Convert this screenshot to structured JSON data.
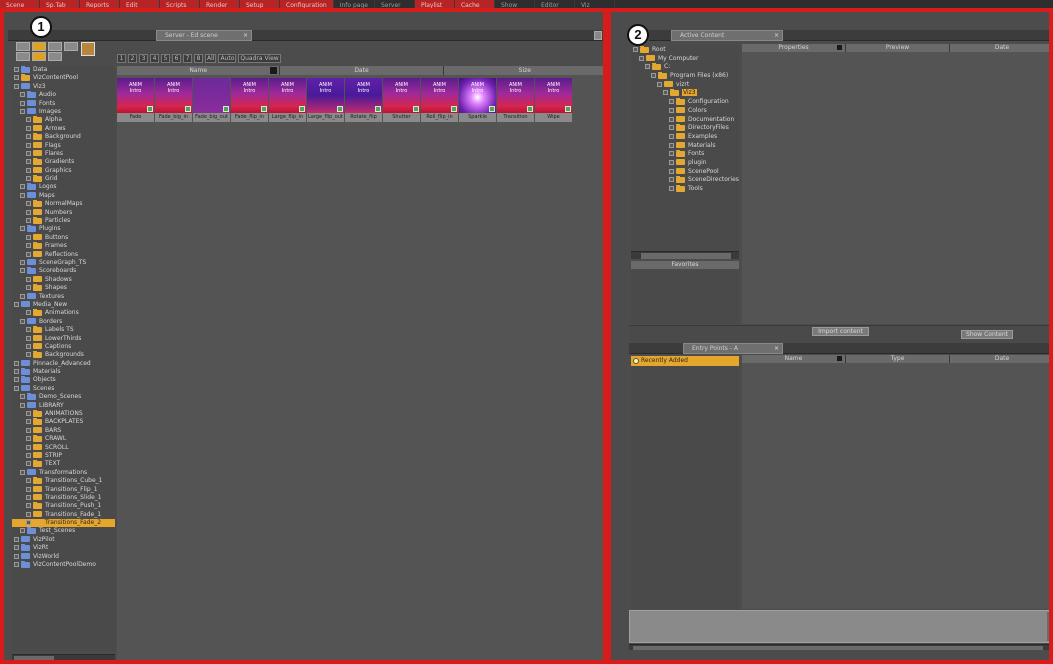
{
  "topbar": {
    "tabs": [
      "Scene",
      "Sp.Tab",
      "Reports",
      "Edit",
      "Scripts",
      "Render",
      "Setup",
      "Configuration",
      "Info page",
      "Server",
      "Playlist",
      "Cache",
      "Show",
      "Editor",
      "Viz"
    ]
  },
  "callouts": {
    "one": "1",
    "two": "2"
  },
  "panel1": {
    "tab_label": "Server - Ed scene",
    "view_toolbar": [
      "1",
      "2",
      "3",
      "4",
      "5",
      "6",
      "7",
      "8",
      "All",
      "Auto",
      "Quadra View"
    ],
    "header": {
      "col1": "Name",
      "col2": "Date",
      "col3": "Size"
    },
    "tree": [
      {
        "label": "Data",
        "depth": 0,
        "icon": "blue"
      },
      {
        "label": "VizContentPool",
        "depth": 0,
        "icon": "orange"
      },
      {
        "label": "Viz3",
        "depth": 0,
        "icon": "blue"
      },
      {
        "label": "Audio",
        "depth": 1,
        "icon": "blue"
      },
      {
        "label": "Fonts",
        "depth": 1,
        "icon": "blue"
      },
      {
        "label": "Images",
        "depth": 1,
        "icon": "blue"
      },
      {
        "label": "Alpha",
        "depth": 2,
        "icon": "orange"
      },
      {
        "label": "Arrows",
        "depth": 2,
        "icon": "orange"
      },
      {
        "label": "Background",
        "depth": 2,
        "icon": "orange"
      },
      {
        "label": "Flags",
        "depth": 2,
        "icon": "orange"
      },
      {
        "label": "Flares",
        "depth": 2,
        "icon": "orange"
      },
      {
        "label": "Gradients",
        "depth": 2,
        "icon": "orange"
      },
      {
        "label": "Graphics",
        "depth": 2,
        "icon": "orange"
      },
      {
        "label": "Grid",
        "depth": 2,
        "icon": "orange"
      },
      {
        "label": "Logos",
        "depth": 1,
        "icon": "blue"
      },
      {
        "label": "Maps",
        "depth": 1,
        "icon": "blue"
      },
      {
        "label": "NormalMaps",
        "depth": 2,
        "icon": "orange"
      },
      {
        "label": "Numbers",
        "depth": 2,
        "icon": "orange"
      },
      {
        "label": "Particles",
        "depth": 2,
        "icon": "orange"
      },
      {
        "label": "Plugins",
        "depth": 1,
        "icon": "blue"
      },
      {
        "label": "Buttons",
        "depth": 2,
        "icon": "orange"
      },
      {
        "label": "Frames",
        "depth": 2,
        "icon": "orange"
      },
      {
        "label": "Reflections",
        "depth": 2,
        "icon": "orange"
      },
      {
        "label": "SceneGraph_TS",
        "depth": 1,
        "icon": "blue"
      },
      {
        "label": "Scoreboards",
        "depth": 1,
        "icon": "blue"
      },
      {
        "label": "Shadows",
        "depth": 2,
        "icon": "orange"
      },
      {
        "label": "Shapes",
        "depth": 2,
        "icon": "orange"
      },
      {
        "label": "Textures",
        "depth": 1,
        "icon": "blue"
      },
      {
        "label": "Media_New",
        "depth": 0,
        "icon": "blue"
      },
      {
        "label": "Animations",
        "depth": 2,
        "icon": "orange"
      },
      {
        "label": "Borders",
        "depth": 1,
        "icon": "blue"
      },
      {
        "label": "Labels TS",
        "depth": 2,
        "icon": "orange"
      },
      {
        "label": "LowerThirds",
        "depth": 2,
        "icon": "orange"
      },
      {
        "label": "Captions",
        "depth": 2,
        "icon": "orange"
      },
      {
        "label": "Backgrounds",
        "depth": 2,
        "icon": "orange"
      },
      {
        "label": "Pinnacle_Advanced",
        "depth": 0,
        "icon": "blue"
      },
      {
        "label": "Materials",
        "depth": 0,
        "icon": "blue"
      },
      {
        "label": "Objects",
        "depth": 0,
        "icon": "blue"
      },
      {
        "label": "Scenes",
        "depth": 0,
        "icon": "blue"
      },
      {
        "label": "Demo_Scenes",
        "depth": 1,
        "icon": "blue"
      },
      {
        "label": "LIBRARY",
        "depth": 1,
        "icon": "blue"
      },
      {
        "label": "ANIMATIONS",
        "depth": 2,
        "icon": "orange"
      },
      {
        "label": "BACKPLATES",
        "depth": 2,
        "icon": "orange"
      },
      {
        "label": "BARS",
        "depth": 2,
        "icon": "orange"
      },
      {
        "label": "CRAWL",
        "depth": 2,
        "icon": "orange"
      },
      {
        "label": "SCROLL",
        "depth": 2,
        "icon": "orange"
      },
      {
        "label": "STRIP",
        "depth": 2,
        "icon": "orange"
      },
      {
        "label": "TEXT",
        "depth": 2,
        "icon": "orange"
      },
      {
        "label": "Transformations",
        "depth": 1,
        "icon": "blue"
      },
      {
        "label": "Transitions_Cube_1",
        "depth": 2,
        "icon": "orange"
      },
      {
        "label": "Transitions_Flip_1",
        "depth": 2,
        "icon": "orange"
      },
      {
        "label": "Transitions_Slide_1",
        "depth": 2,
        "icon": "orange"
      },
      {
        "label": "Transitions_Push_1",
        "depth": 2,
        "icon": "orange"
      },
      {
        "label": "Transitions_Fade_1",
        "depth": 2,
        "icon": "orange"
      },
      {
        "label": "Transitions_Fade_2",
        "depth": 2,
        "icon": "orange",
        "selected": true
      },
      {
        "label": "Test_Scenes",
        "depth": 1,
        "icon": "blue"
      },
      {
        "label": "VizPilot",
        "depth": 0,
        "icon": "blue"
      },
      {
        "label": "VizRt",
        "depth": 0,
        "icon": "blue"
      },
      {
        "label": "VizWorld",
        "depth": 0,
        "icon": "blue"
      },
      {
        "label": "VizContentPoolDemo",
        "depth": 0,
        "icon": "blue"
      }
    ],
    "thumbnails": [
      {
        "title": "ANIM",
        "sub": "Intro",
        "caption": "Fade",
        "style": "std"
      },
      {
        "title": "ANIM",
        "sub": "Intro",
        "caption": "Fade_big_in",
        "style": "std"
      },
      {
        "title": "",
        "sub": "",
        "caption": "Fade_big_out",
        "style": "dark"
      },
      {
        "title": "ANIM",
        "sub": "Intro",
        "caption": "Fade_flip_in",
        "style": "std"
      },
      {
        "title": "ANIM",
        "sub": "Intro",
        "caption": "Large_flip_in",
        "style": "std"
      },
      {
        "title": "ANIM",
        "sub": "Intro",
        "caption": "Large_flip_out",
        "style": "violet"
      },
      {
        "title": "ANIM",
        "sub": "Intro",
        "caption": "Rotate_flip",
        "style": "violet"
      },
      {
        "title": "ANIM",
        "sub": "Intro",
        "caption": "Shutter",
        "style": "std"
      },
      {
        "title": "ANIM",
        "sub": "Intro",
        "caption": "Roll_flip_in",
        "style": "std"
      },
      {
        "title": "ANIM",
        "sub": "Intro",
        "caption": "Sparkle",
        "style": "glow"
      },
      {
        "title": "ANIM",
        "sub": "Intro",
        "caption": "Transition",
        "style": "std"
      },
      {
        "title": "ANIM",
        "sub": "Intro",
        "caption": "Wipe",
        "style": "std"
      }
    ]
  },
  "panel2": {
    "tab_label": "Active Content",
    "grid_header": {
      "col1": "Properties",
      "col2": "Preview",
      "col3": "Date"
    },
    "tree": [
      {
        "label": "Root",
        "depth": 0,
        "icon": "orange"
      },
      {
        "label": "My Computer",
        "depth": 1,
        "icon": "orange"
      },
      {
        "label": "C:",
        "depth": 2,
        "icon": "orange"
      },
      {
        "label": "Program Files (x86)",
        "depth": 3,
        "icon": "orange"
      },
      {
        "label": "vizrt",
        "depth": 4,
        "icon": "orange"
      },
      {
        "label": "Viz3",
        "depth": 5,
        "icon": "orange",
        "selected": true
      },
      {
        "label": "Configuration",
        "depth": 6,
        "icon": "orange"
      },
      {
        "label": "Colors",
        "depth": 6,
        "icon": "orange"
      },
      {
        "label": "Documentation",
        "depth": 6,
        "icon": "orange"
      },
      {
        "label": "DirectoryFiles",
        "depth": 6,
        "icon": "orange"
      },
      {
        "label": "Examples",
        "depth": 6,
        "icon": "orange"
      },
      {
        "label": "Materials",
        "depth": 6,
        "icon": "orange"
      },
      {
        "label": "Fonts",
        "depth": 6,
        "icon": "orange"
      },
      {
        "label": "plugin",
        "depth": 6,
        "icon": "orange"
      },
      {
        "label": "ScenePool",
        "depth": 6,
        "icon": "orange"
      },
      {
        "label": "SceneDirectories",
        "depth": 6,
        "icon": "orange"
      },
      {
        "label": "Tools",
        "depth": 6,
        "icon": "orange"
      }
    ],
    "favorites_label": "Favorites",
    "import_button": "Import content",
    "show_content_button": "Show Content",
    "lower_tab_label": "Entry Points - A",
    "lower_item": "Recently Added",
    "lower_header": {
      "col1": "Name",
      "col2": "Type",
      "col3": "Date"
    }
  }
}
